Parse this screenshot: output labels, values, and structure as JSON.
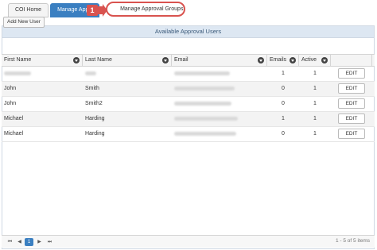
{
  "tabs": [
    {
      "label": "COI Home"
    },
    {
      "label": "Manage Approval Users"
    },
    {
      "label": "Manage Approval Groups"
    }
  ],
  "callout_number": "1",
  "panel": {
    "title": "Available Approval Users",
    "add_button": "Add New User"
  },
  "columns": [
    "First Name",
    "Last Name",
    "Email",
    "Emails",
    "Active",
    ""
  ],
  "rows": [
    {
      "first": "",
      "last": "",
      "email": "",
      "emails": "1",
      "active": "1",
      "edit": "EDIT"
    },
    {
      "first": "John",
      "last": "Smith",
      "email": "",
      "emails": "0",
      "active": "1",
      "edit": "EDIT"
    },
    {
      "first": "John",
      "last": "Smith2",
      "email": "",
      "emails": "0",
      "active": "1",
      "edit": "EDIT"
    },
    {
      "first": "Michael",
      "last": "Harding",
      "email": "",
      "emails": "1",
      "active": "1",
      "edit": "EDIT"
    },
    {
      "first": "Michael",
      "last": "Harding",
      "email": "",
      "emails": "0",
      "active": "1",
      "edit": "EDIT"
    }
  ],
  "pager": {
    "first": "⏮",
    "prev": "◀",
    "page": "1",
    "next": "▶",
    "last": "⏭",
    "info": "1 - 5 of 5 items"
  },
  "colors": {
    "accent": "#3a7fc1",
    "callout": "#d9534f",
    "header_bg": "#dde7f2"
  }
}
